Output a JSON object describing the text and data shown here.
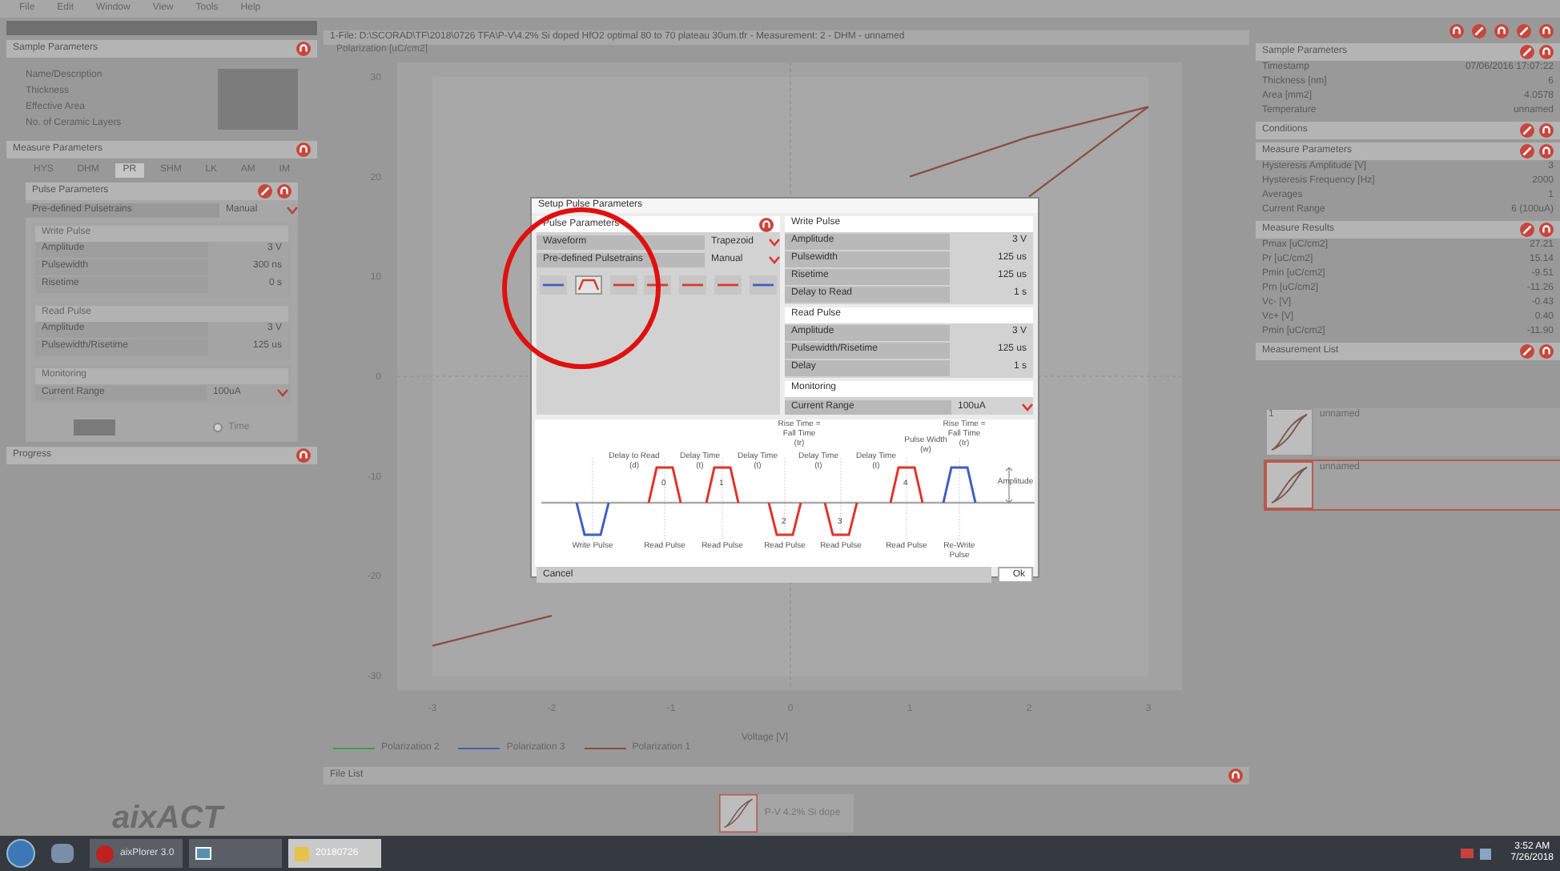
{
  "menu": [
    "File",
    "Edit",
    "Window",
    "View",
    "Tools",
    "Help"
  ],
  "left": {
    "sample_title": "Sample Parameters",
    "sample_fields": [
      "Name/Description",
      "Thickness",
      "Effective Area",
      "No. of Ceramic Layers"
    ],
    "measure_title": "Measure Parameters",
    "tabs": [
      {
        "label": "HYS",
        "selected": false
      },
      {
        "label": "DHM",
        "selected": false
      },
      {
        "label": "PR",
        "selected": true
      },
      {
        "label": "SHM",
        "selected": false
      },
      {
        "label": "LK",
        "selected": false
      },
      {
        "label": "AM",
        "selected": false
      },
      {
        "label": "IM",
        "selected": false
      }
    ],
    "pulse_title": "Pulse Parameters",
    "pulsetrain": {
      "label": "Pre-defined Pulsetrains",
      "value": "Manual"
    },
    "write": {
      "title": "Write Pulse",
      "rows": [
        {
          "label": "Amplitude",
          "value": "3 V"
        },
        {
          "label": "Pulsewidth",
          "value": "300 ns"
        },
        {
          "label": "Risetime",
          "value": "0 s"
        }
      ]
    },
    "read": {
      "title": "Read Pulse",
      "rows": [
        {
          "label": "Amplitude",
          "value": "3 V"
        },
        {
          "label": "Pulsewidth/Risetime",
          "value": "125 us"
        }
      ]
    },
    "monitoring": {
      "title": "Monitoring",
      "label": "Current Range",
      "value": "100uA"
    },
    "time_option": {
      "label": "Time",
      "selected": false
    },
    "progress_title": "Progress",
    "logo": "aixACT"
  },
  "center": {
    "title": "1-File: D:\\SCORAD\\TF\\2018\\0726 TFA\\P-V\\4.2% Si doped HfO2 optimal 80 to 70 plateau 30um.tfr - Measurement: 2 - DHM - unnamed",
    "chart_data": {
      "type": "line",
      "ylabel": "Polarization [uC/cm2]",
      "xlabel": "Voltage [V]",
      "x": [
        -3,
        -2,
        1,
        2,
        3
      ],
      "series": [
        {
          "name": "Polarization 1",
          "color": "#8a4f46",
          "values": [
            -27,
            -24,
            null,
            18,
            27
          ]
        },
        {
          "color": "#8a4f46",
          "values": [
            null,
            null,
            20,
            24,
            27
          ]
        }
      ],
      "xticks": [
        -3,
        -2,
        -1,
        0,
        1,
        2,
        3
      ],
      "yticks": [
        30,
        20,
        10,
        0,
        -10,
        -20,
        -30
      ],
      "xlim": [
        -3,
        3
      ],
      "ylim": [
        -30,
        30
      ]
    },
    "legend": [
      {
        "label": "Polarization 2",
        "color": "#3f9a4f"
      },
      {
        "label": "Polarization 3",
        "color": "#4a5fb0"
      }
    ],
    "file_list_title": "File List",
    "file_item": "P-V 4.2% Si dope"
  },
  "right": {
    "sections": [
      {
        "title": "Sample Parameters",
        "rows": [
          {
            "label": "Timestamp",
            "value": "07/06/2016 17:07:22"
          },
          {
            "label": "Thickness [nm]",
            "value": "6"
          },
          {
            "label": "Area [mm2]",
            "value": "4.0578"
          },
          {
            "label": "Temperature",
            "value": "unnamed"
          }
        ]
      },
      {
        "title": "Conditions"
      },
      {
        "title": "Measure Parameters",
        "rows": [
          {
            "label": "Hysteresis Amplitude [V]",
            "value": "3"
          },
          {
            "label": "Hysteresis Frequency [Hz]",
            "value": "2000"
          },
          {
            "label": "Averages",
            "value": "1"
          },
          {
            "label": "Current Range",
            "value": "6 (100uA)"
          }
        ]
      },
      {
        "title": "Measure Results",
        "rows": [
          {
            "label": "Pmax [uC/cm2]",
            "value": "27.21"
          },
          {
            "label": "Pr [uC/cm2]",
            "value": "15.14"
          },
          {
            "label": "Pmin [uC/cm2]",
            "value": "-9.51"
          },
          {
            "label": "Prn [uC/cm2]",
            "value": "-11.26"
          },
          {
            "label": "Vc- [V]",
            "value": "-0.43"
          },
          {
            "label": "Vc+ [V]",
            "value": "0.40"
          },
          {
            "label": "Pmin [uC/cm2]",
            "value": "-11.90"
          }
        ]
      },
      {
        "title": "Measurement List"
      }
    ],
    "measurements": [
      {
        "number": "1",
        "name": "unnamed",
        "selected": false
      },
      {
        "name": "unnamed",
        "selected": true
      }
    ]
  },
  "dialog": {
    "title": "Setup Pulse Parameters",
    "pulse_title": "Pulse Parameters",
    "selects": [
      {
        "label": "Waveform",
        "value": "Trapezoid"
      },
      {
        "label": "Pre-defined Pulsetrains",
        "value": "Manual"
      }
    ],
    "pulse_buttons": [
      {
        "kind": "line",
        "color": "#3f5fc0",
        "selected": false
      },
      {
        "kind": "trapezoid",
        "color": "#d63a2f",
        "selected": true
      },
      {
        "kind": "line",
        "color": "#d63a2f",
        "selected": false
      },
      {
        "kind": "line",
        "color": "#d63a2f",
        "selected": false
      },
      {
        "kind": "line",
        "color": "#d63a2f",
        "selected": false
      },
      {
        "kind": "line",
        "color": "#d63a2f",
        "selected": false
      },
      {
        "kind": "line",
        "color": "#3f5fc0",
        "selected": false
      }
    ],
    "groups": [
      {
        "title": "Write Pulse",
        "rows": [
          {
            "label": "Amplitude",
            "value": "3 V"
          },
          {
            "label": "Pulsewidth",
            "value": "125 us"
          },
          {
            "label": "Risetime",
            "value": "125 us"
          },
          {
            "label": "Delay to Read",
            "value": "1 s"
          }
        ]
      },
      {
        "title": "Read Pulse",
        "rows": [
          {
            "label": "Amplitude",
            "value": "3 V"
          },
          {
            "label": "Pulsewidth/Risetime",
            "value": "125 us"
          },
          {
            "label": "Delay",
            "value": "1 s"
          }
        ]
      }
    ],
    "monitoring": {
      "title": "Monitoring",
      "label": "Current Range",
      "value": "100uA"
    },
    "diagram": {
      "pulses": [
        {
          "kind": "down",
          "color": "#3f5fc0",
          "label": "Write Pulse"
        },
        {
          "kind": "up",
          "color": "#e0342a",
          "number": "0",
          "label": "Read Pulse"
        },
        {
          "kind": "up",
          "color": "#e0342a",
          "number": "1",
          "label": "Read Pulse"
        },
        {
          "kind": "down",
          "color": "#e0342a",
          "number": "2",
          "label": "Read Pulse"
        },
        {
          "kind": "down",
          "color": "#e0342a",
          "number": "3",
          "label": "Read Pulse"
        },
        {
          "kind": "up",
          "color": "#e0342a",
          "number": "4",
          "label": "Read Pulse"
        },
        {
          "kind": "up",
          "color": "#3f5fc0",
          "label": "Re-Write Pulse"
        }
      ],
      "annotations": [
        {
          "text": "Delay to Read",
          "sub": "(d)"
        },
        {
          "text": "Delay Time",
          "sub": "(t)"
        },
        {
          "text": "Delay Time",
          "sub": "(t)"
        },
        {
          "text": "Rise Time = Fall Time",
          "sub": "(tr)"
        },
        {
          "text": "Delay Time",
          "sub": "(t)"
        },
        {
          "text": "Delay Time",
          "sub": "(t)"
        },
        {
          "text": "Pulse Width",
          "sub": "(w)"
        },
        {
          "text": "Rise Time = Fall Time",
          "sub": "(tr)"
        },
        {
          "text": "Amplitude"
        }
      ]
    },
    "cancel": "Cancel",
    "ok": "Ok"
  },
  "taskbar": {
    "apps": [
      {
        "label": "aixPlorer 3.0",
        "kind": "app"
      },
      {
        "kind": "window"
      },
      {
        "label": "20180726",
        "kind": "folder"
      }
    ],
    "time": "3:52 AM",
    "date": "7/26/2018"
  }
}
